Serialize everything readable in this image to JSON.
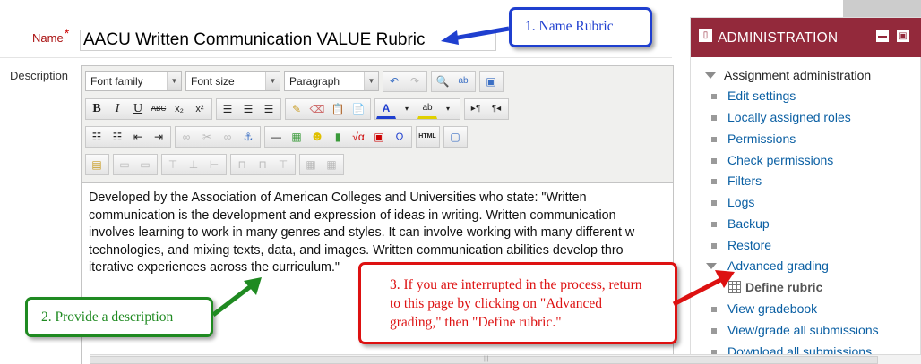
{
  "form": {
    "name_label": "Name",
    "required_mark": "*",
    "name_value": "AACU Written Communication VALUE Rubric",
    "description_label": "Description"
  },
  "editor": {
    "font_family": "Font family",
    "font_size": "Font size",
    "paragraph": "Paragraph",
    "content_lines": [
      "Developed by the Association of American Colleges and Universities who state: \"Written",
      "communication is the development and expression of ideas in writing. Written communication",
      "involves learning to work in many genres and styles. It can involve working with many different w",
      "technologies, and mixing texts, data, and images. Written communication abilities develop thro",
      "iterative experiences across the curriculum.\""
    ]
  },
  "admin": {
    "title": "ADMINISTRATION",
    "root": "Assignment administration",
    "items": [
      "Edit settings",
      "Locally assigned roles",
      "Permissions",
      "Check permissions",
      "Filters",
      "Logs",
      "Backup",
      "Restore"
    ],
    "advanced": "Advanced grading",
    "define": "Define rubric",
    "after_items": [
      "View gradebook",
      "View/grade all submissions",
      "Download all submissions"
    ]
  },
  "callouts": {
    "c1": "1. Name Rubric",
    "c2": "2. Provide a description",
    "c3_lines": [
      "3. If you are interrupted in the process, return",
      "to this page by clicking on \"Advanced",
      "grading,\" then \"Define rubric.\""
    ]
  },
  "colors": {
    "admin_header": "#93293b",
    "link": "#0a5fa3",
    "callout_blue": "#1f3fcf",
    "callout_green": "#1f8a21",
    "callout_red": "#dd1111"
  }
}
